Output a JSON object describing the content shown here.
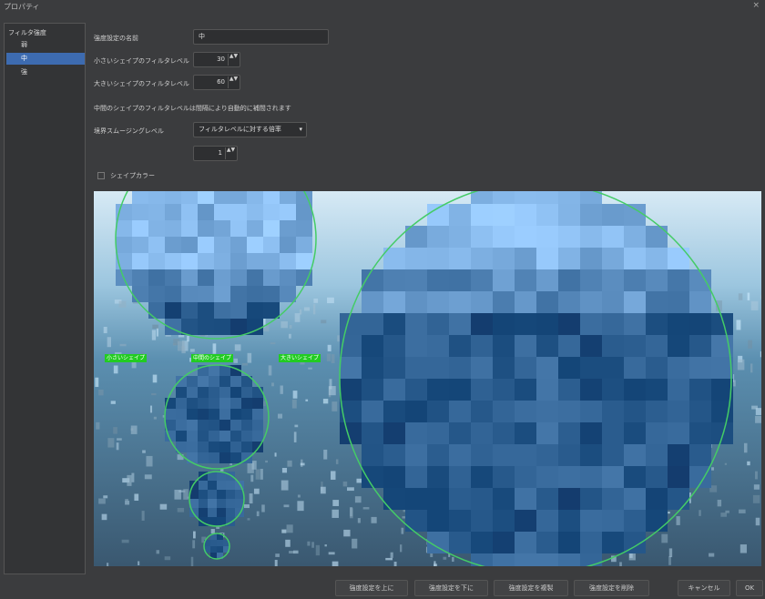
{
  "window": {
    "title": "プロパティ",
    "close": "×"
  },
  "tree": {
    "root": "フィルタ強度",
    "items": [
      {
        "label": "弱",
        "selected": false
      },
      {
        "label": "中",
        "selected": true
      },
      {
        "label": "強",
        "selected": false
      }
    ]
  },
  "form": {
    "name_label": "強度設定の名前",
    "name_value": "中",
    "small_label": "小さいシェイプのフィルタレベル",
    "small_value": "30",
    "large_label": "大きいシェイプのフィルタレベル",
    "large_value": "60",
    "note": "中間のシェイプのフィルタレベルは間隔により自動的に補間されます",
    "smoothing_label": "境界スムージングレベル",
    "smoothing_mode": "フィルタレベルに対する倍率",
    "smoothing_value": "1",
    "shape_color_label": "シェイプカラー",
    "shape_color_checked": false
  },
  "preview": {
    "labels": {
      "small": "小さいシェイプ",
      "medium": "中間のシェイプ",
      "large": "大きいシェイプ"
    },
    "circle_color": "#44cc66",
    "label_color": "#22cc22"
  },
  "buttons": {
    "up": "強度設定を上に",
    "down": "強度設定を下に",
    "duplicate": "強度設定を複製",
    "delete": "強度設定を削除",
    "cancel": "キャンセル",
    "ok": "OK"
  },
  "spin_arrows": "▲▼",
  "dropdown_arrow": "▾"
}
